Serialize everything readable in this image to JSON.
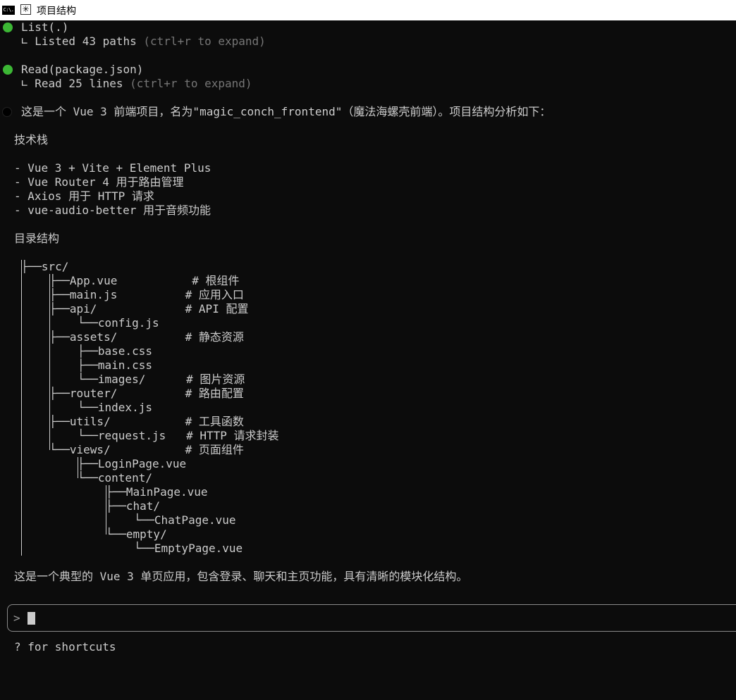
{
  "window": {
    "title": "项目结构",
    "cmd_icon_text": "C:\\."
  },
  "colors": {
    "background": "#0c0c0c",
    "text": "#cccccc",
    "dim": "#767676",
    "success_dot": "#16c60c"
  },
  "tool_calls": [
    {
      "call": "List(.)",
      "result": "∟ Listed 43 paths",
      "hint": " (ctrl+r to expand)"
    },
    {
      "call": "Read(package.json)",
      "result": "∟ Read 25 lines",
      "hint": " (ctrl+r to expand)"
    }
  ],
  "response": {
    "intro": "这是一个 Vue 3 前端项目，名为\"magic_conch_frontend\"（魔法海螺壳前端）。项目结构分析如下：",
    "tech_heading": "技术栈",
    "tech_items": [
      "- Vue 3 + Vite + Element Plus",
      "- Vue Router 4 用于路由管理",
      "- Axios 用于 HTTP 请求",
      "- vue-audio-better 用于音频功能"
    ],
    "dir_heading": "目录结构",
    "tree": [
      "├──src/",
      "├──App.vue           # 根组件",
      "├──main.js          # 应用入口",
      "├──api/             # API 配置",
      "└──config.js",
      "├──assets/          # 静态资源",
      "├──base.css",
      "├──main.css",
      "└──images/      # 图片资源",
      "├──router/          # 路由配置",
      "└──index.js",
      "├──utils/           # 工具函数",
      "└──request.js   # HTTP 请求封装",
      "└──views/           # 页面组件",
      "├──LoginPage.vue",
      "└──content/",
      "├──MainPage.vue",
      "├──chat/",
      "└──ChatPage.vue",
      "└──empty/",
      "└──EmptyPage.vue"
    ],
    "summary": "这是一个典型的 Vue 3 单页应用，包含登录、聊天和主页功能，具有清晰的模块化结构。"
  },
  "input": {
    "caret": ">",
    "value": ""
  },
  "footer": {
    "hint": "? for shortcuts"
  }
}
